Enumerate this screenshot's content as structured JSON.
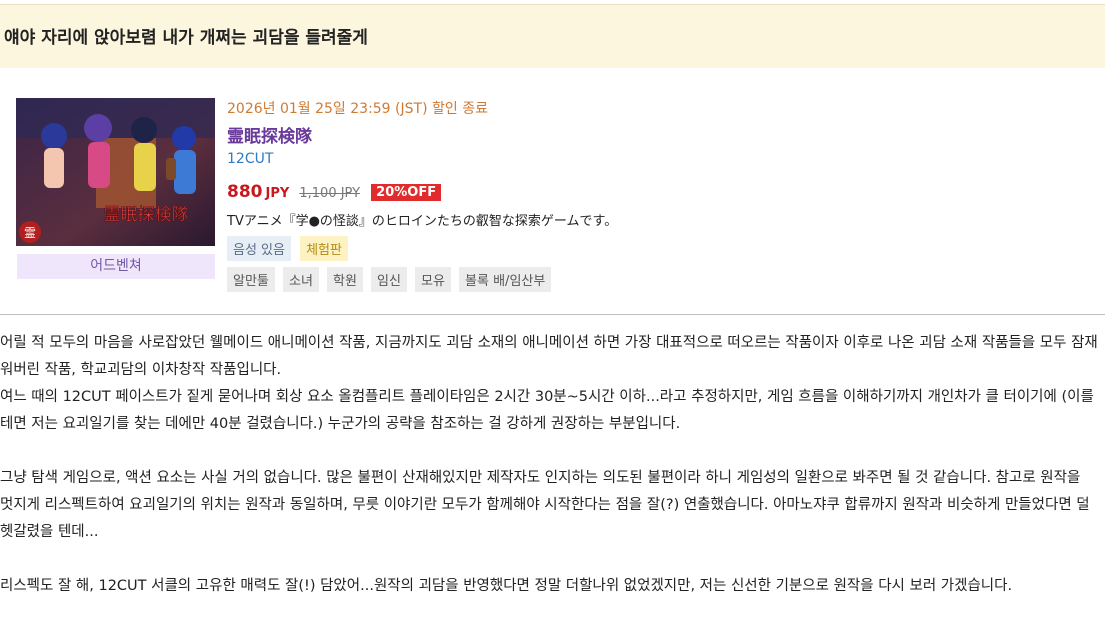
{
  "header": {
    "title": "얘야 자리에 앉아보렴 내가 개쩌는 괴담을 들려줄게"
  },
  "product": {
    "sale_end": "2026년 01월 25일 23:59 (JST) 할인 종료",
    "title": "霊眠探検隊",
    "circle": "12CUT",
    "price": "880",
    "currency": "JPY",
    "original_price": "1,100 JPY",
    "discount": "20%OFF",
    "description": "TVアニメ『学●の怪談』のヒロインたちの叡智な探索ゲームです。",
    "thumbnail_logo_text": "霊眠探検隊",
    "genre": "어드벤쳐",
    "badges": {
      "voice": "음성 있음",
      "trial": "체험판"
    },
    "tags": [
      "알만툴",
      "소녀",
      "학원",
      "임신",
      "모유",
      "볼록 배/임산부"
    ]
  },
  "review": {
    "p1": "어릴 적 모두의 마음을 사로잡았던 웰메이드 애니메이션 작품, 지금까지도 괴담 소재의 애니메이션 하면 가장 대표적으로 떠오르는 작품이자 이후로 나온 괴담 소재 작품들을 모두 잠재워버린 작품, 학교괴담의 이차창작 작품입니다.",
    "p2": "여느 때의 12CUT 페이스트가 짙게 묻어나며 회상 요소 올컴플리트 플레이타임은 2시간 30분~5시간 이하...라고 추정하지만, 게임 흐름을 이해하기까지 개인차가 클 터이기에 (이를테면 저는 요괴일기를 찾는 데에만 40분 걸렸습니다.) 누군가의 공략을 참조하는 걸 강하게 권장하는 부분입니다.",
    "p3": "그냥 탐색 게임으로, 액션 요소는 사실 거의 없습니다. 많은 불편이 산재해있지만 제작자도 인지하는 의도된 불편이라 하니 게임성의 일환으로 봐주면 될 것 같습니다. 참고로 원작을 멋지게 리스펙트하여 요괴일기의 위치는 원작과 동일하며, 무릇 이야기란 모두가 함께해야 시작한다는 점을 잘(?) 연출했습니다. 아마노쟈쿠 합류까지 원작과 비슷하게 만들었다면 덜 헷갈렸을 텐데...",
    "p4": "리스펙도 잘 해, 12CUT 서클의 고유한 매력도 잘(!) 담았어...원작의 괴담을 반영했다면 정말 더할나위 없었겠지만, 저는 신선한 기분으로 원작을 다시 보러 가겠습니다."
  }
}
